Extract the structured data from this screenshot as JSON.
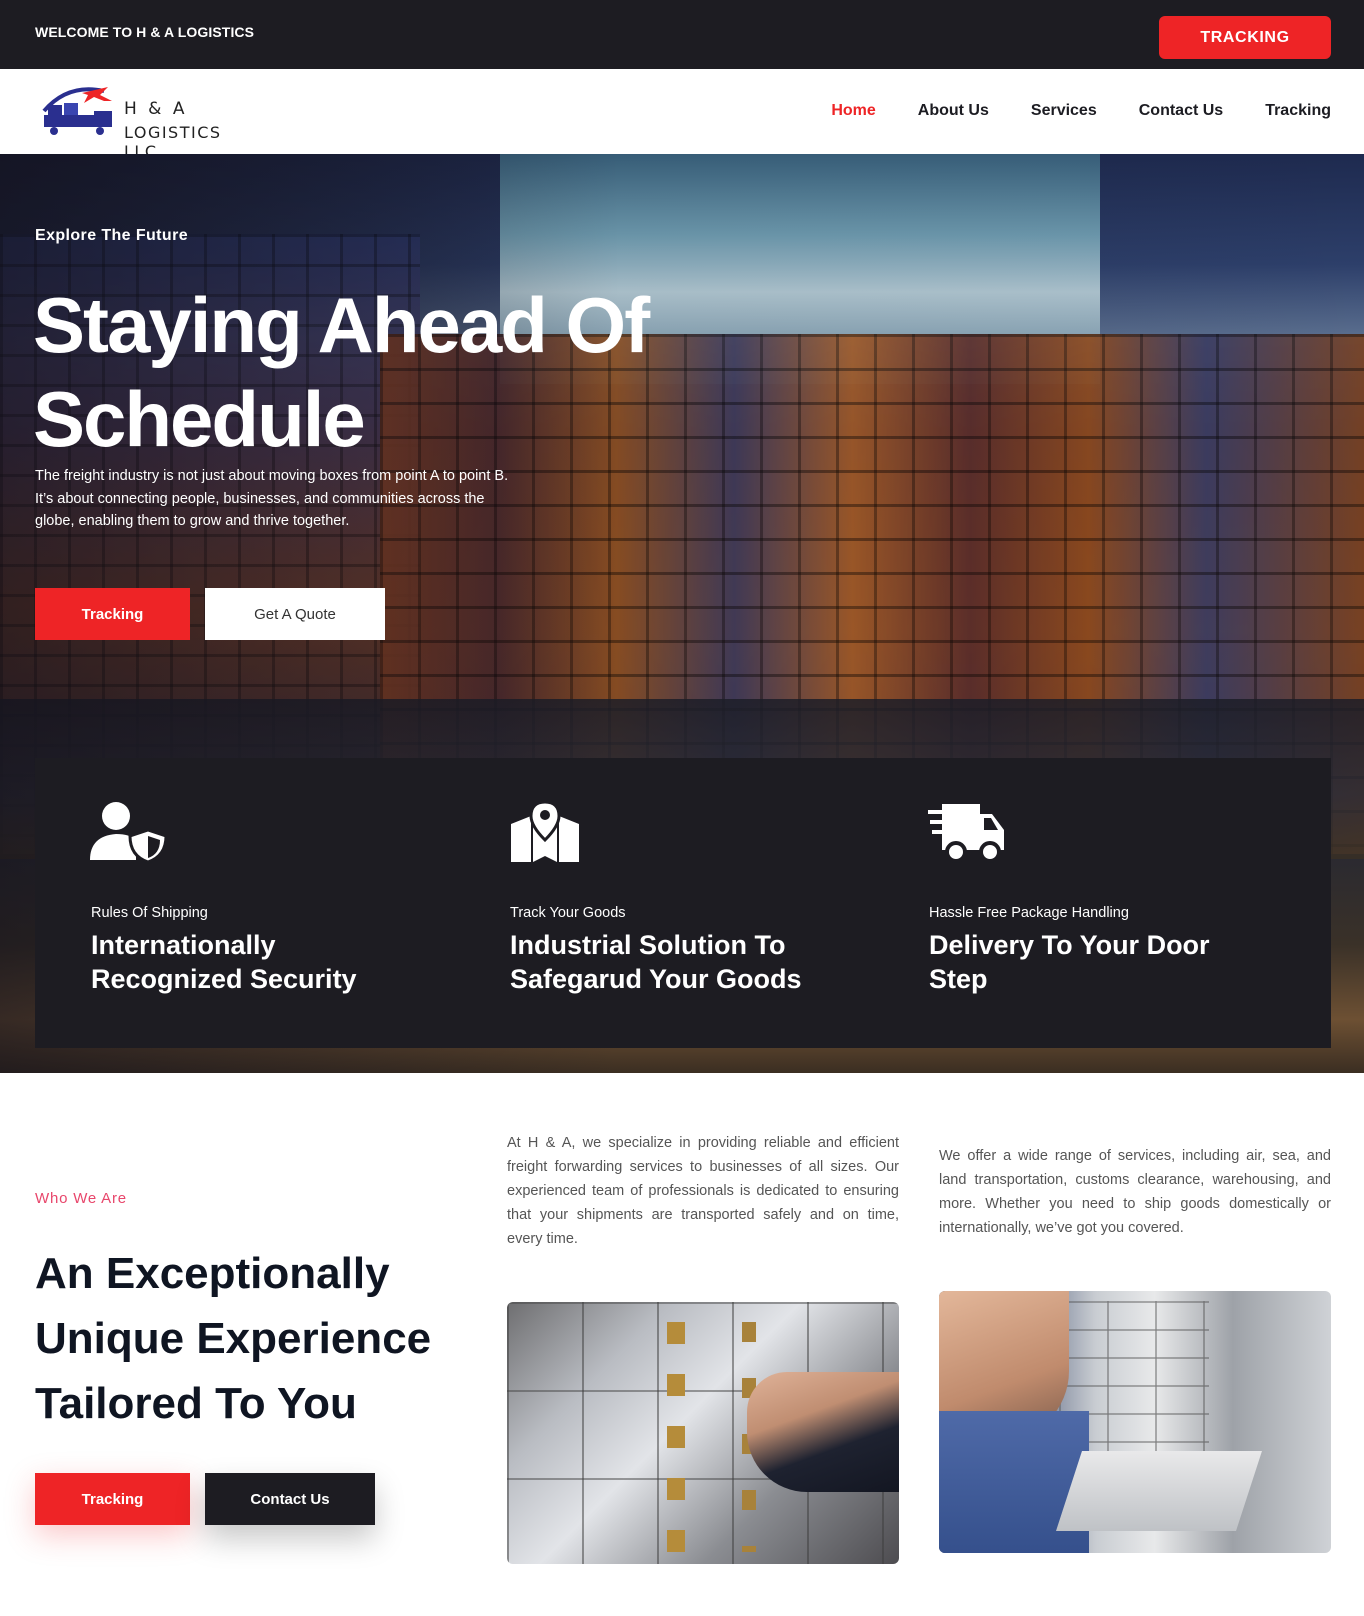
{
  "topbar": {
    "welcome": "WELCOME TO H & A LOGISTICS",
    "tracking_button": "TRACKING"
  },
  "logo": {
    "line1": "H & A",
    "line2": "LOGISTICS LLC",
    "icon": "ship-truck-plane-logo"
  },
  "nav": {
    "items": [
      {
        "label": "Home",
        "active": true
      },
      {
        "label": "About Us",
        "active": false
      },
      {
        "label": "Services",
        "active": false
      },
      {
        "label": "Contact Us",
        "active": false
      },
      {
        "label": "Tracking",
        "active": false
      }
    ]
  },
  "hero": {
    "eyebrow": "Explore The Future",
    "title": "Staying Ahead Of Schedule",
    "text": "The freight industry is not just about moving boxes from point A to point B. It’s about connecting people, businesses, and communities across the globe, enabling them to grow and thrive together.",
    "primary_button": "Tracking",
    "secondary_button": "Get A Quote",
    "background": "container-ship-image"
  },
  "features": [
    {
      "icon": "user-shield-icon",
      "subtitle": "Rules Of Shipping",
      "title": "Internationally Recognized Security"
    },
    {
      "icon": "map-pin-icon",
      "subtitle": "Track Your Goods",
      "title": "Industrial Solution To Safegarud Your Goods"
    },
    {
      "icon": "shipping-truck-icon",
      "subtitle": "Hassle Free Package Handling",
      "title": "Delivery To Your Door Step"
    }
  ],
  "about": {
    "eyebrow": "Who We Are",
    "title": "An Exceptionally Unique Experience Tailored To You",
    "paragraph1": "At H & A, we specialize in providing reliable and efficient freight forwarding services to businesses of all sizes. Our experienced team of professionals is dedicated to ensuring that your shipments are transported safely and on time, every time.",
    "paragraph2": "We offer a wide range of services, including air, sea, and land transportation, customs clearance, warehousing, and more. Whether you need to ship goods domestically or internationally, we’ve got you covered.",
    "primary_button": "Tracking",
    "secondary_button": "Contact Us",
    "image1": "safe-deposit-box-key-photo",
    "image2": "man-at-safe-deposit-drawer-photo"
  },
  "colors": {
    "accent": "#ee2426",
    "dark": "#1d1c22",
    "eyebrow_pink": "#e8466b"
  }
}
